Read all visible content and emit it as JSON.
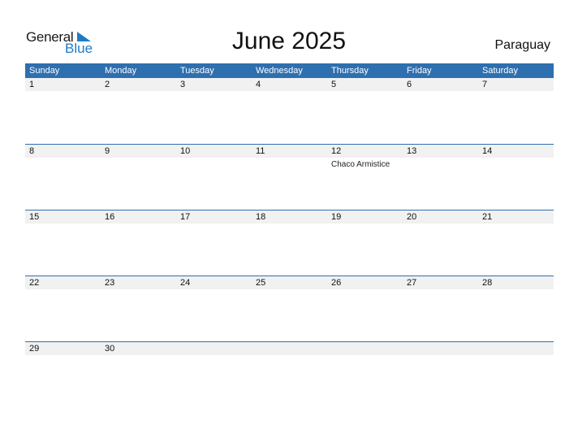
{
  "logo": {
    "line1": "General",
    "line2": "Blue"
  },
  "title": "June 2025",
  "country": "Paraguay",
  "weekdays": [
    "Sunday",
    "Monday",
    "Tuesday",
    "Wednesday",
    "Thursday",
    "Friday",
    "Saturday"
  ],
  "weeks": [
    {
      "days": [
        "1",
        "2",
        "3",
        "4",
        "5",
        "6",
        "7"
      ]
    },
    {
      "days": [
        "8",
        "9",
        "10",
        "11",
        "12",
        "13",
        "14"
      ]
    },
    {
      "days": [
        "15",
        "16",
        "17",
        "18",
        "19",
        "20",
        "21"
      ]
    },
    {
      "days": [
        "22",
        "23",
        "24",
        "25",
        "26",
        "27",
        "28"
      ]
    },
    {
      "days": [
        "29",
        "30",
        "",
        "",
        "",
        "",
        ""
      ]
    }
  ],
  "events": {
    "week1_thursday": "Chaco Armistice"
  },
  "colors": {
    "header": "#2e6fb0",
    "brand_blue": "#1e7bc8",
    "day_strip": "#f1f1f1"
  }
}
